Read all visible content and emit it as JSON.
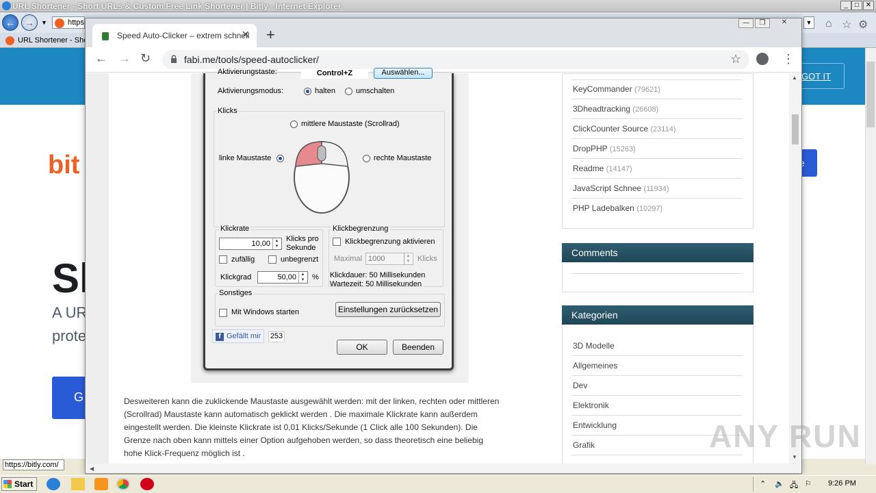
{
  "ie": {
    "title": "URL Shortener - Short URLs & Custom Free Link Shortener | Bitly - Internet Explorer",
    "address_text": "https",
    "tab_label": "URL Shortener - Sho",
    "status_url": "https://bitly.com/"
  },
  "bitly": {
    "logo": "bit",
    "hero": "Sl",
    "sub1": "A UR",
    "sub2": "prote",
    "cta": "G",
    "got_it": "GOT IT",
    "btn2": "e"
  },
  "chrome": {
    "tab_title": "Speed Auto-Clicker – extrem schnell",
    "url": "fabi.me/tools/speed-autoclicker/"
  },
  "dialog": {
    "activation_key_label": "Aktivierungstaste:",
    "activation_key_value": "Control+Z",
    "select_button": "Auswählen...",
    "mode_label": "Aktivierungsmodus:",
    "mode_hold": "halten",
    "mode_toggle": "umschalten",
    "clicks_group": "Klicks",
    "middle_button": "mittlere Maustaste (Scrollrad)",
    "left_button": "linke Maustaste",
    "right_button": "rechte Maustaste",
    "rate_group": "Klickrate",
    "rate_value": "10,00",
    "rate_unit_line1": "Klicks pro",
    "rate_unit_line2": "Sekunde",
    "random": "zufällig",
    "unlimited": "unbegrenzt",
    "degree_label": "Klickgrad",
    "degree_value": "50,00",
    "degree_unit": "%",
    "limit_group": "Klickbegrenzung",
    "limit_enable": "Klickbegrenzung aktivieren",
    "max_label": "Maximal",
    "max_value": "1000",
    "max_unit": "Klicks",
    "duration": "Klickdauer: 50 Millisekunden",
    "wait": "Wartezeit: 50 Millisekunden",
    "misc_group": "Sonstiges",
    "windows_start": "Mit Windows starten",
    "reset_button": "Einstellungen zurücksetzen",
    "like_label": "Gefällt mir",
    "like_count": "253",
    "ok_button": "OK",
    "exit_button": "Beenden"
  },
  "article": {
    "lines": [
      "Desweiteren kann die zuklickende Maustaste ausgewählt werden: mit der linken, rechten oder mittleren",
      "(Scrollrad) Maustaste kann automatisch geklickt werden . Die maximale Klickrate kann außerdem",
      "eingestellt werden. Die kleinste Klickrate ist 0,01 Klicks/Sekunde (1 Click alle 100 Sekunden). Die",
      "Grenze nach oben kann mittels einer Option aufgehoben werden, so dass theoretisch eine beliebig",
      "hohe Klick-Frequenz möglich ist ."
    ]
  },
  "sidebar": {
    "tools": [
      {
        "name": "KeyCommander",
        "count": "(79621)"
      },
      {
        "name": "3Dheadtracking",
        "count": "(26608)"
      },
      {
        "name": "ClickCounter Source",
        "count": "(23114)"
      },
      {
        "name": "DropPHP",
        "count": "(15263)"
      },
      {
        "name": "Readme",
        "count": "(14147)"
      },
      {
        "name": "JavaScript Schnee",
        "count": "(11934)"
      },
      {
        "name": "PHP Ladebalken",
        "count": "(10297)"
      }
    ],
    "comments_title": "Comments",
    "categories_title": "Kategorien",
    "categories": [
      "3D Modelle",
      "Allgemeines",
      "Dev",
      "Elektronik",
      "Entwicklung",
      "Grafik"
    ]
  },
  "taskbar": {
    "start": "Start",
    "clock": "9:26 PM"
  },
  "watermark": "ANY RUN"
}
